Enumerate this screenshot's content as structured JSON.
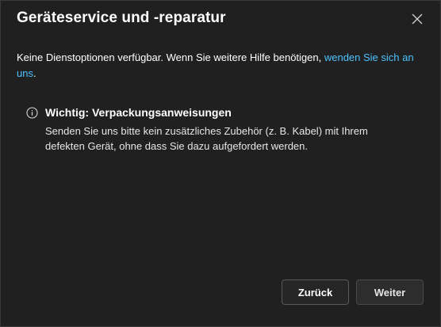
{
  "dialog": {
    "title": "Geräteservice und -reparatur",
    "close_icon": "close-icon",
    "intro_text": "Keine Dienstoptionen verfügbar. Wenn Sie weitere Hilfe benötigen, ",
    "intro_link": "wenden Sie sich an uns",
    "intro_end": ".",
    "notice": {
      "icon": "info-icon",
      "title": "Wichtig: Verpackungsanweisungen",
      "body": "Senden Sie uns bitte kein zusätzliches Zubehör (z. B. Kabel) mit Ihrem defekten Gerät, ohne dass Sie dazu aufgefordert werden."
    },
    "buttons": {
      "back_label": "Zurück",
      "next_label": "Weiter"
    }
  },
  "colors": {
    "background": "#202020",
    "link": "#4cc2ff",
    "text": "#ffffff"
  }
}
